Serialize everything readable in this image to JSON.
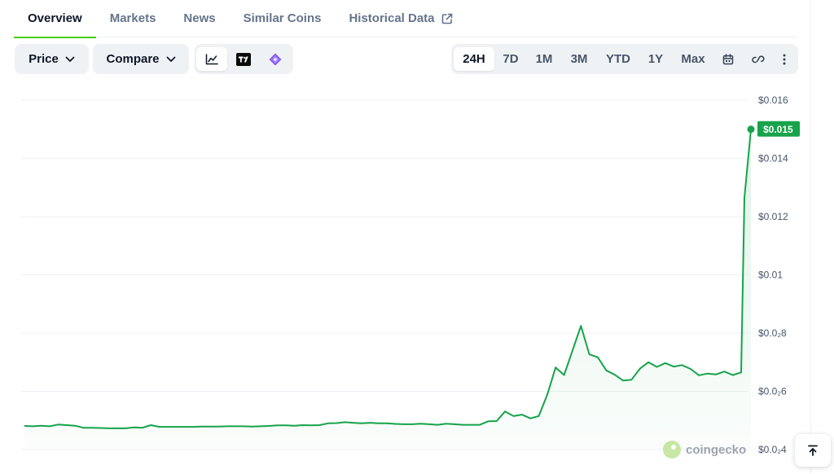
{
  "tabs": [
    {
      "label": "Overview",
      "active": true
    },
    {
      "label": "Markets"
    },
    {
      "label": "News"
    },
    {
      "label": "Similar Coins"
    },
    {
      "label": "Historical Data",
      "icon": "external-link-icon"
    }
  ],
  "toolbar": {
    "price_label": "Price",
    "compare_label": "Compare",
    "views": [
      {
        "name": "line-chart-icon",
        "active": true
      },
      {
        "name": "tradingview-icon"
      },
      {
        "name": "diamond-icon"
      }
    ],
    "ranges": [
      "24H",
      "7D",
      "1M",
      "3M",
      "YTD",
      "1Y",
      "Max"
    ],
    "active_range": "24H",
    "icons": [
      "calendar-icon",
      "link-icon",
      "more-vertical-icon"
    ]
  },
  "chart_data": {
    "type": "line",
    "title": "",
    "xlabel": "",
    "ylabel": "",
    "y_tick_labels": [
      "$0.016",
      "$0.014",
      "$0.012",
      "$0.01",
      "$0.0₂8",
      "$0.0₂6",
      "$0.0₂4"
    ],
    "y_ticks": [
      0.016,
      0.014,
      0.012,
      0.01,
      0.008,
      0.006,
      0.004
    ],
    "ylim": [
      0.004,
      0.016
    ],
    "grid": true,
    "current_price_label": "$0.015",
    "series": [
      {
        "color": "#16a34a",
        "values": [
          0.00481,
          0.0048,
          0.00482,
          0.0048,
          0.00486,
          0.00484,
          0.00482,
          0.00475,
          0.00475,
          0.00474,
          0.00473,
          0.00473,
          0.00473,
          0.00476,
          0.00475,
          0.00484,
          0.00478,
          0.00478,
          0.00478,
          0.00478,
          0.00478,
          0.00479,
          0.00479,
          0.00479,
          0.0048,
          0.0048,
          0.0048,
          0.00479,
          0.0048,
          0.00481,
          0.00483,
          0.00483,
          0.00482,
          0.00484,
          0.00483,
          0.00484,
          0.0049,
          0.00491,
          0.00494,
          0.00492,
          0.0049,
          0.00492,
          0.0049,
          0.0049,
          0.00488,
          0.00487,
          0.00487,
          0.00489,
          0.00487,
          0.00485,
          0.00489,
          0.00487,
          0.00485,
          0.00485,
          0.00485,
          0.00497,
          0.00498,
          0.00531,
          0.00515,
          0.0052,
          0.00507,
          0.00515,
          0.00588,
          0.00682,
          0.00656,
          0.0074,
          0.00825,
          0.00727,
          0.00717,
          0.00672,
          0.00657,
          0.00637,
          0.0064,
          0.00678,
          0.007,
          0.00684,
          0.00697,
          0.00685,
          0.0069,
          0.00677,
          0.00655,
          0.00661,
          0.00658,
          0.00668,
          0.00656,
          0.00665,
          0.01265,
          0.015
        ]
      }
    ]
  },
  "watermark": "coingecko",
  "scroll_top_icon": "arrow-up-to-line-icon",
  "colors": {
    "accent_green": "#4bcc00",
    "line_green": "#16a34a",
    "badge_green": "#16a34a"
  }
}
